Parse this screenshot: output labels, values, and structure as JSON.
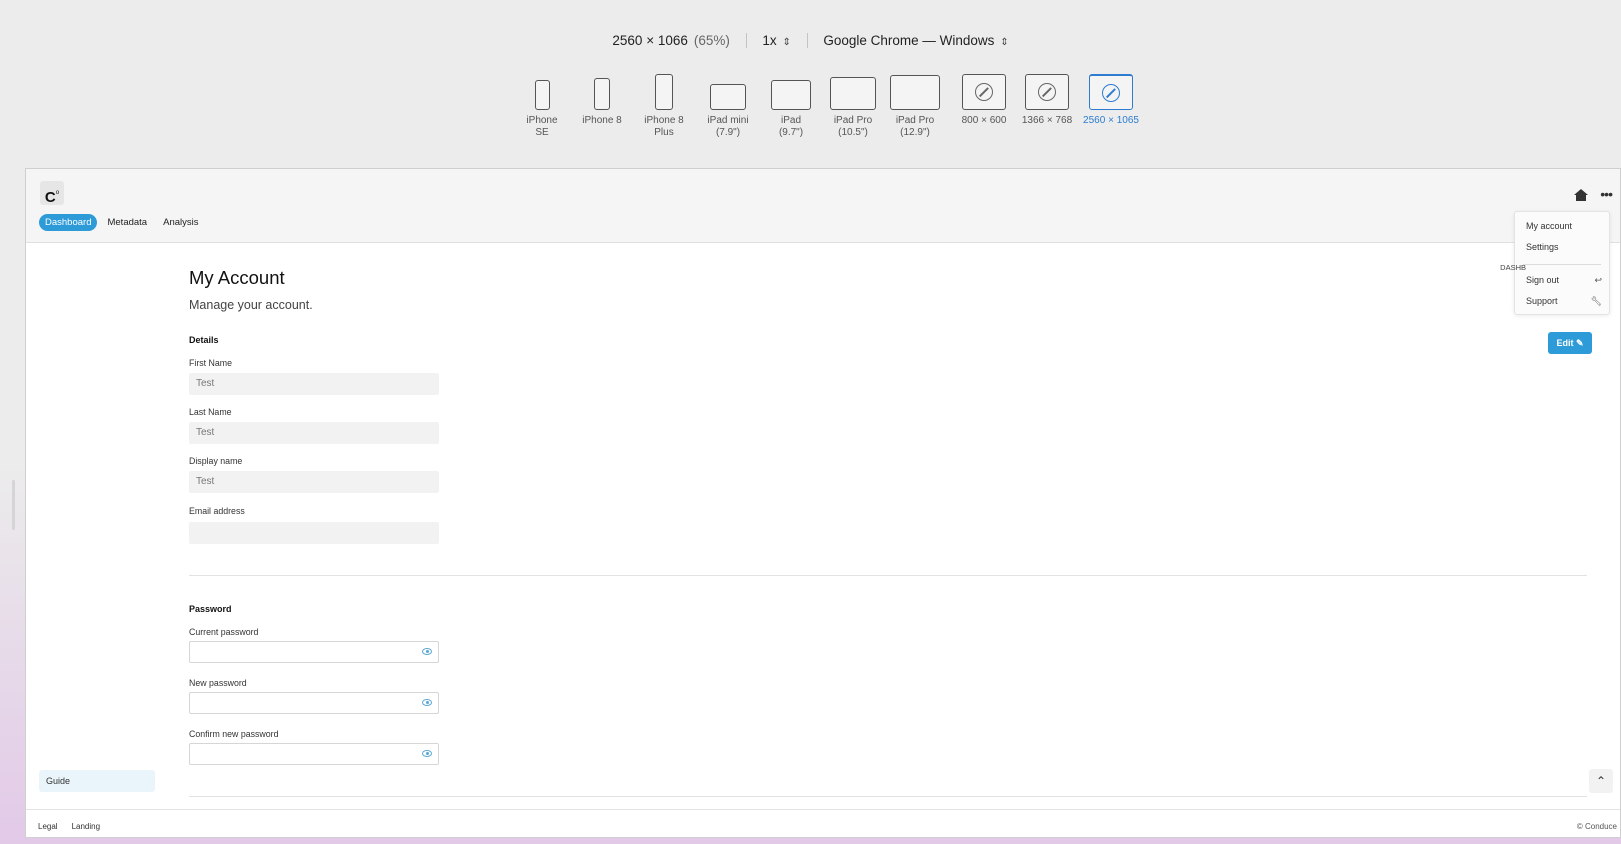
{
  "toolbar": {
    "resolution": "2560 × 1066",
    "zoom": "(65%)",
    "scale": "1x",
    "browser": "Google Chrome — Windows",
    "devices": [
      {
        "label": "iPhone SE",
        "sub": ""
      },
      {
        "label": "iPhone 8",
        "sub": ""
      },
      {
        "label": "iPhone 8",
        "sub": "Plus"
      },
      {
        "label": "iPad mini",
        "sub": "(7.9\")"
      },
      {
        "label": "iPad",
        "sub": "(9.7\")"
      },
      {
        "label": "iPad Pro",
        "sub": "(10.5\")"
      },
      {
        "label": "iPad Pro",
        "sub": "(12.9\")"
      },
      {
        "label": "800 × 600",
        "sub": ""
      },
      {
        "label": "1366 × 768",
        "sub": ""
      },
      {
        "label": "2560 × 1065",
        "sub": ""
      }
    ]
  },
  "app": {
    "logo": "C",
    "logo_mark": "o",
    "nav": [
      "Dashboard",
      "Metadata",
      "Analysis"
    ]
  },
  "page": {
    "title": "My Account",
    "subtitle": "Manage your account.",
    "breadcrumb": "DASHB",
    "edit_label": "Edit"
  },
  "details": {
    "heading": "Details",
    "first_name_label": "First Name",
    "first_name_value": "Test",
    "last_name_label": "Last Name",
    "last_name_value": "Test",
    "display_name_label": "Display name",
    "display_name_value": "Test",
    "email_label": "Email address",
    "email_value": ""
  },
  "password": {
    "heading": "Password",
    "current_label": "Current password",
    "new_label": "New password",
    "confirm_label": "Confirm new password"
  },
  "menu": {
    "my_account": "My account",
    "settings": "Settings",
    "sign_out": "Sign out",
    "support": "Support"
  },
  "sidebar": {
    "guide": "Guide"
  },
  "footer": {
    "links": [
      "Legal",
      "Landing"
    ],
    "copyright": "© Conduce"
  },
  "colors": {
    "accent": "#2d9bd8",
    "device_selected": "#2d7ccf"
  }
}
